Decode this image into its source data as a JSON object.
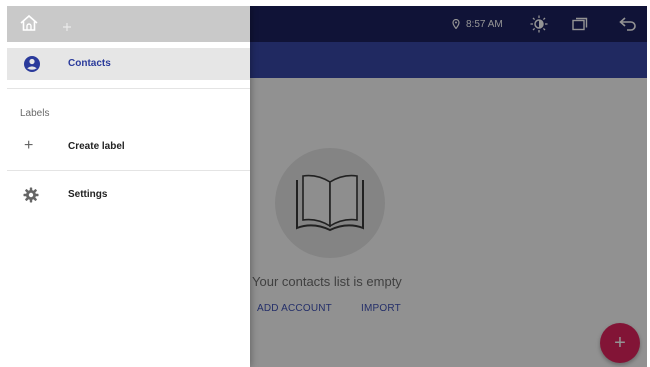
{
  "status_bar": {
    "time": "8:57 AM",
    "icons": [
      "home-icon",
      "location-pin-icon",
      "brightness-icon",
      "recent-apps-icon",
      "back-icon"
    ]
  },
  "drawer": {
    "items": [
      {
        "label": "Contacts",
        "icon": "account-circle-icon",
        "selected": true
      },
      {
        "label": "Create label",
        "icon": "plus-icon"
      },
      {
        "label": "Settings",
        "icon": "gear-icon"
      }
    ],
    "section_header": "Labels"
  },
  "main": {
    "empty_message": "Your contacts list is empty",
    "actions": {
      "add_account": "ADD ACCOUNT",
      "import": "IMPORT"
    },
    "fab_symbol": "+"
  },
  "colors": {
    "status_bar": "#1c2160",
    "app_bar": "#3747a8",
    "accent": "#3f51b5",
    "fab": "#e0245e",
    "drawer_selected": "#e6e6e6"
  }
}
